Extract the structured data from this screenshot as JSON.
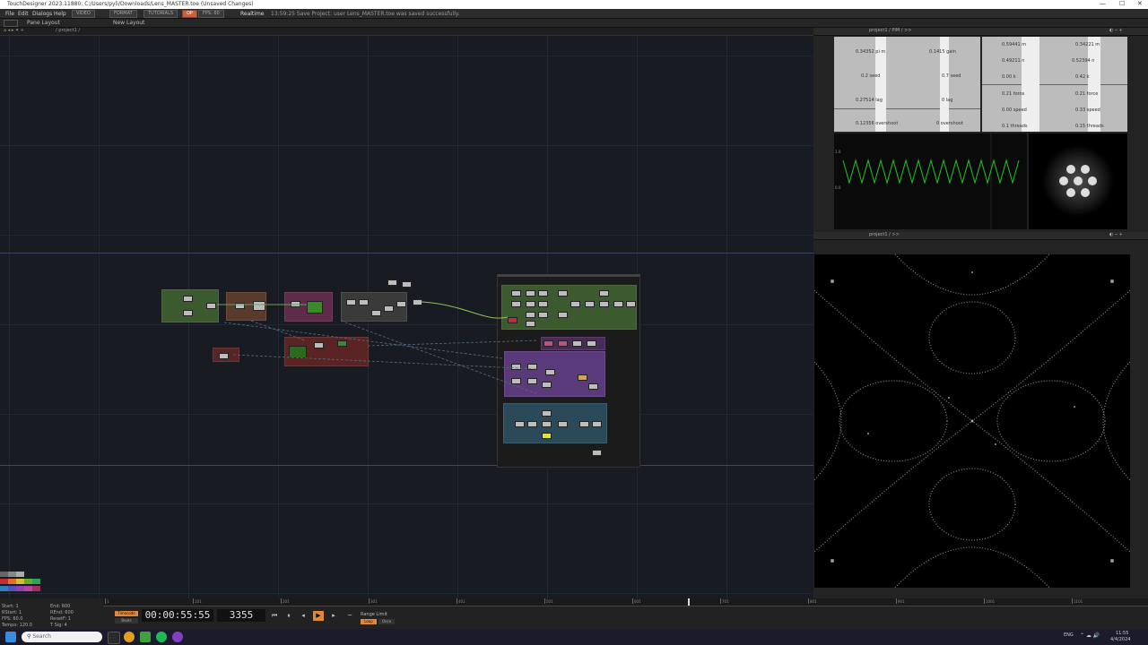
{
  "window": {
    "title": "TouchDesigner 2023.11880: C:/Users/pyli/Downloads/Lens_MASTER.toe (Unsaved Changes)",
    "controls": [
      "—",
      "☐",
      "✕"
    ]
  },
  "menubar": {
    "items": [
      "File",
      "Edit",
      "Dialogs",
      "Help"
    ],
    "tabs": [
      "VIDEO",
      "FORMAT",
      "TUTORIALS",
      "OP",
      "FPS: 60"
    ],
    "realtime_label": "Realtime",
    "status": "13:59:25 Save Project: user Lens_MASTER.toe was saved successfully."
  },
  "toolbar2": {
    "pane_layout": "Pane Layout",
    "new_layout": "New Layout"
  },
  "network": {
    "path": "/ project1 /"
  },
  "rightpanel": {
    "top_path": "project1 / PIM / >>",
    "bottom_path": "project1 / >>"
  },
  "info_left": [
    {
      "value": "0.34352",
      "label": "pi m"
    },
    {
      "value": "0.1415",
      "label": "gain"
    },
    {
      "value": "0.2",
      "label": "seed"
    },
    {
      "value": "0.7",
      "label": "seed"
    },
    {
      "value": "0.27514",
      "label": "lag"
    },
    {
      "value": "0",
      "label": "lag"
    },
    {
      "value": "0.12356",
      "label": "overshoot"
    },
    {
      "value": "0",
      "label": "overshoot"
    }
  ],
  "info_right": [
    {
      "value": "0.59441",
      "label": "m"
    },
    {
      "value": "0.34221",
      "label": "m"
    },
    {
      "value": "0.49211",
      "label": "n"
    },
    {
      "value": "0.52394",
      "label": "n"
    },
    {
      "value": "0.00",
      "label": "k"
    },
    {
      "value": "0.42",
      "label": "k"
    },
    {
      "value": "0.21",
      "label": "force"
    },
    {
      "value": "0.21",
      "label": "force"
    },
    {
      "value": "0.00",
      "label": "speed"
    },
    {
      "value": "0.33",
      "label": "speed"
    },
    {
      "value": "0.1",
      "label": "threads"
    },
    {
      "value": "0.15",
      "label": "threads"
    }
  ],
  "scope": {
    "top_label": "1.0",
    "mid_label": "0.0",
    "color": "#22c422"
  },
  "timeline": {
    "ticks": [
      "1",
      "101",
      "201",
      "301",
      "401",
      "501",
      "601",
      "701",
      "801",
      "901",
      "1001",
      "1101"
    ],
    "timecode": "00:00:55:55",
    "frame": "3355",
    "timecode_btn": "Timecode",
    "beats_btn": "Beats",
    "range_label": "Range Limit",
    "range_opt1": "Loop",
    "range_opt2": "Once",
    "accent": "#e0883a"
  },
  "stats": [
    {
      "k": "Start:",
      "v": "1"
    },
    {
      "k": "RStart:",
      "v": "1"
    },
    {
      "k": "FPS:",
      "v": "60.0"
    },
    {
      "k": "Tempo:",
      "v": "120.0"
    },
    {
      "k": "End:",
      "v": "600"
    },
    {
      "k": "REnd:",
      "v": "600"
    },
    {
      "k": "ResetF:",
      "v": "1"
    },
    {
      "k": "T Sig:",
      "v": "4"
    }
  ],
  "taskbar": {
    "search_placeholder": "Search",
    "time": "11:55",
    "date": "4/4/2024",
    "lang": "ENG"
  }
}
